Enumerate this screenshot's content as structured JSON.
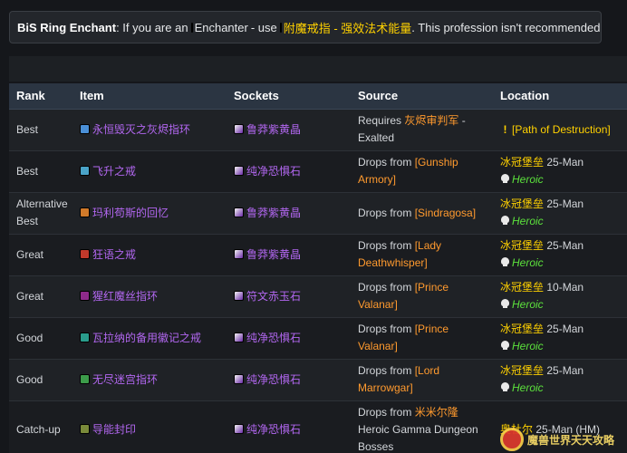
{
  "notice": {
    "label": "BiS Ring Enchant",
    "text_before": ": If you are an",
    "profession": "Enchanter",
    "text_mid": "- use",
    "spell": "附魔戒指 - 强效法术能量",
    "text_after": ". This profession isn't recommended."
  },
  "table": {
    "headers": {
      "rank": "Rank",
      "item": "Item",
      "sockets": "Sockets",
      "source": "Source",
      "location": "Location"
    },
    "rows": [
      {
        "rank": "Best",
        "item": "永恒毁灭之灰烬指环",
        "item_icon_color": "#4a8fd6",
        "socket": "鲁莽紫黄晶",
        "source_prefix": "Requires",
        "source_link": "灰烬审判军",
        "source_suffix": "-",
        "source_line2": "Exalted",
        "loc_zone": "[Path of Destruction]",
        "loc_size": "",
        "loc_heroic": ""
      },
      {
        "rank": "Best",
        "item": "飞升之戒",
        "item_icon_color": "#4aa3c8",
        "socket": "纯净恐惧石",
        "source_prefix": "Drops from",
        "source_link": "[Gunship Armory]",
        "source_suffix": "",
        "source_line2": "",
        "loc_zone": "冰冠堡垒",
        "loc_size": "25-Man",
        "loc_heroic": "Heroic"
      },
      {
        "rank": "Alternative Best",
        "item": "玛利苟斯的回忆",
        "item_icon_color": "#d07a2a",
        "socket": "鲁莽紫黄晶",
        "source_prefix": "Drops from",
        "source_link": "[Sindragosa]",
        "source_suffix": "",
        "source_line2": "",
        "loc_zone": "冰冠堡垒",
        "loc_size": "25-Man",
        "loc_heroic": "Heroic"
      },
      {
        "rank": "Great",
        "item": "狂语之戒",
        "item_icon_color": "#c0392b",
        "socket": "鲁莽紫黄晶",
        "source_prefix": "Drops from",
        "source_link": "[Lady Deathwhisper]",
        "source_suffix": "",
        "source_line2": "",
        "loc_zone": "冰冠堡垒",
        "loc_size": "25-Man",
        "loc_heroic": "Heroic"
      },
      {
        "rank": "Great",
        "item": "猩红魔丝指环",
        "item_icon_color": "#8e2a8a",
        "socket": "符文赤玉石",
        "source_prefix": "Drops from",
        "source_link": "[Prince Valanar]",
        "source_suffix": "",
        "source_line2": "",
        "loc_zone": "冰冠堡垒",
        "loc_size": "10-Man",
        "loc_heroic": "Heroic"
      },
      {
        "rank": "Good",
        "item": "瓦拉纳的备用徽记之戒",
        "item_icon_color": "#2a9c8c",
        "socket": "纯净恐惧石",
        "source_prefix": "Drops from",
        "source_link": "[Prince Valanar]",
        "source_suffix": "",
        "source_line2": "",
        "loc_zone": "冰冠堡垒",
        "loc_size": "25-Man",
        "loc_heroic": "Heroic"
      },
      {
        "rank": "Good",
        "item": "无尽迷宫指环",
        "item_icon_color": "#3c9c4a",
        "socket": "纯净恐惧石",
        "source_prefix": "Drops from",
        "source_link": "[Lord Marrowgar]",
        "source_suffix": "",
        "source_line2": "",
        "loc_zone": "冰冠堡垒",
        "loc_size": "25-Man",
        "loc_heroic": "Heroic"
      },
      {
        "rank": "Catch-up",
        "item": "导能封印",
        "item_icon_color": "#7a8a3a",
        "socket": "纯净恐惧石",
        "source_prefix": "Drops from",
        "source_link": "米米尔隆",
        "source_suffix": "",
        "source_line2": "Heroic Gamma Dungeon Bosses",
        "loc_zone": "奥杜尔",
        "loc_size": "25-Man (HM)",
        "loc_heroic": ""
      }
    ]
  },
  "watermark": {
    "text": "魔兽世界天天攻略"
  },
  "colors": {
    "epic": "#b267f0",
    "legendary_link": "#ff9a2e",
    "zone": "#ffd100",
    "heroic": "#5ce23c",
    "header_bg": "#2b3542"
  },
  "icons": {
    "socket_gem": "gem-icon",
    "heroic_marker": "skull-icon",
    "quest_marker": "exclamation-icon"
  }
}
